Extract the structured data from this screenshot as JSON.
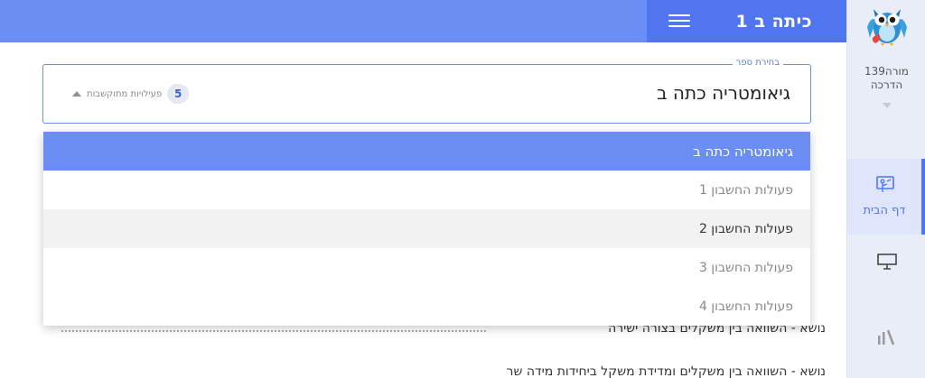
{
  "header": {
    "class_title": "כיתה ב 1"
  },
  "sidebar": {
    "user_name": "מורה139",
    "user_role": "הדרכה",
    "home_label": "דף הבית",
    "icons": [
      "owl-logo",
      "home-board-icon",
      "presentation-icon",
      "stats-icon"
    ]
  },
  "book_select": {
    "label": "בחירת ספר",
    "value": "גיאומטריה כתה ב",
    "related_count": "5",
    "related_label": "פעילויות מתוקשבות"
  },
  "dropdown": {
    "options": [
      {
        "label": "גיאומטריה כתה ב",
        "state": "selected"
      },
      {
        "label": "פעולות החשבון 1",
        "state": "normal"
      },
      {
        "label": "פעולות החשבון 2",
        "state": "hover"
      },
      {
        "label": "פעולות החשבון 3",
        "state": "normal"
      },
      {
        "label": "פעולות החשבון 4",
        "state": "normal"
      }
    ]
  },
  "content": {
    "topic_1": "נושא - השוואה בין משקלים בצורה ישירה",
    "topic_2": "נושא - השוואה בין משקלים ומדידת משקל ביחידות מידה שר"
  },
  "colors": {
    "accent": "#6b8ef5",
    "accent_dark": "#4f76ee",
    "sidebar_bg": "#e9edf8"
  }
}
